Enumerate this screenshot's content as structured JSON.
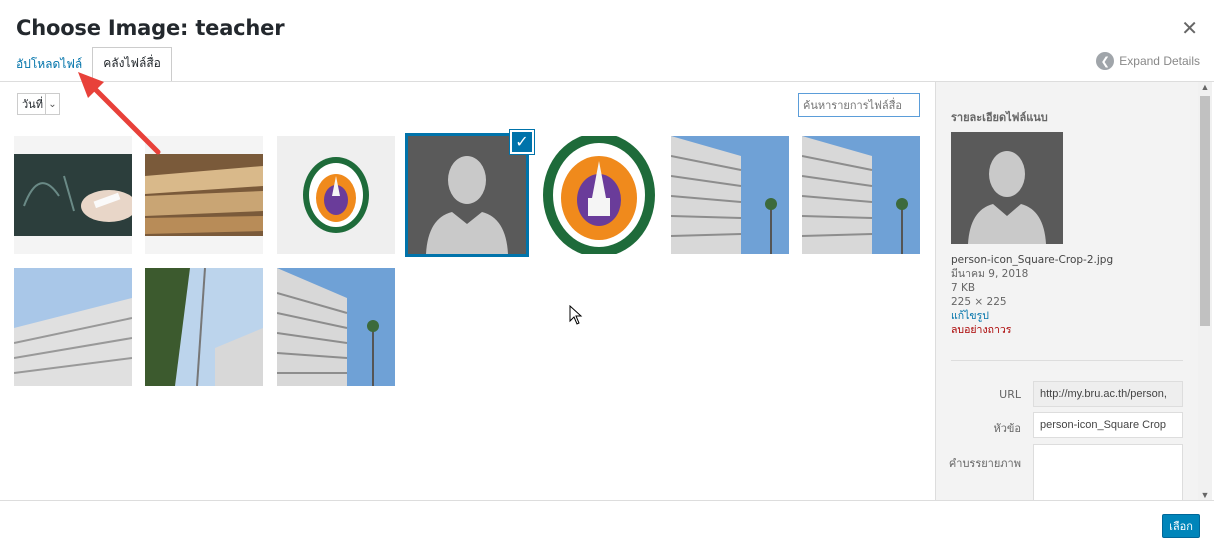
{
  "modal": {
    "title": "Choose Image: teacher",
    "close_icon": "close-icon"
  },
  "tabs": [
    {
      "label": "อัปโหลดไฟล์",
      "active": false
    },
    {
      "label": "คลังไฟล์สื่อ",
      "active": true
    }
  ],
  "expand_details": {
    "label": "Expand Details",
    "icon": "chevron-left-icon"
  },
  "filter": {
    "date_label": "วันที่"
  },
  "search": {
    "placeholder": "ค้นหารายการไฟล์สื่อ"
  },
  "grid": {
    "items": [
      {
        "name": "chalkboard-image",
        "selected": false
      },
      {
        "name": "books-image",
        "selected": false
      },
      {
        "name": "university-seal-small-image",
        "selected": false
      },
      {
        "name": "person-icon-image",
        "selected": true
      },
      {
        "name": "university-seal-large-image",
        "selected": false
      },
      {
        "name": "building-image-1",
        "selected": false
      },
      {
        "name": "building-image-2",
        "selected": false
      },
      {
        "name": "building-image-3",
        "selected": false
      },
      {
        "name": "flagpole-building-image",
        "selected": false
      },
      {
        "name": "building-image-4",
        "selected": false
      }
    ]
  },
  "sidebar": {
    "title": "รายละเอียดไฟล์แนบ",
    "filename": "person-icon_Square-Crop-2.jpg",
    "date": "มีนาคม 9, 2018",
    "size": "7 KB",
    "dimensions": "225 × 225",
    "edit_label": "แก้ไขรูป",
    "delete_label": "ลบอย่างถาวร",
    "fields": {
      "url_label": "URL",
      "url_value": "http://my.bru.ac.th/person,",
      "title_label": "หัวข้อ",
      "title_value": "person-icon_Square Crop",
      "caption_label": "คำบรรยายภาพ",
      "caption_value": ""
    }
  },
  "footer": {
    "select_label": "เลือก"
  },
  "colors": {
    "accent": "#0073aa",
    "arrow": "#e8413a"
  }
}
